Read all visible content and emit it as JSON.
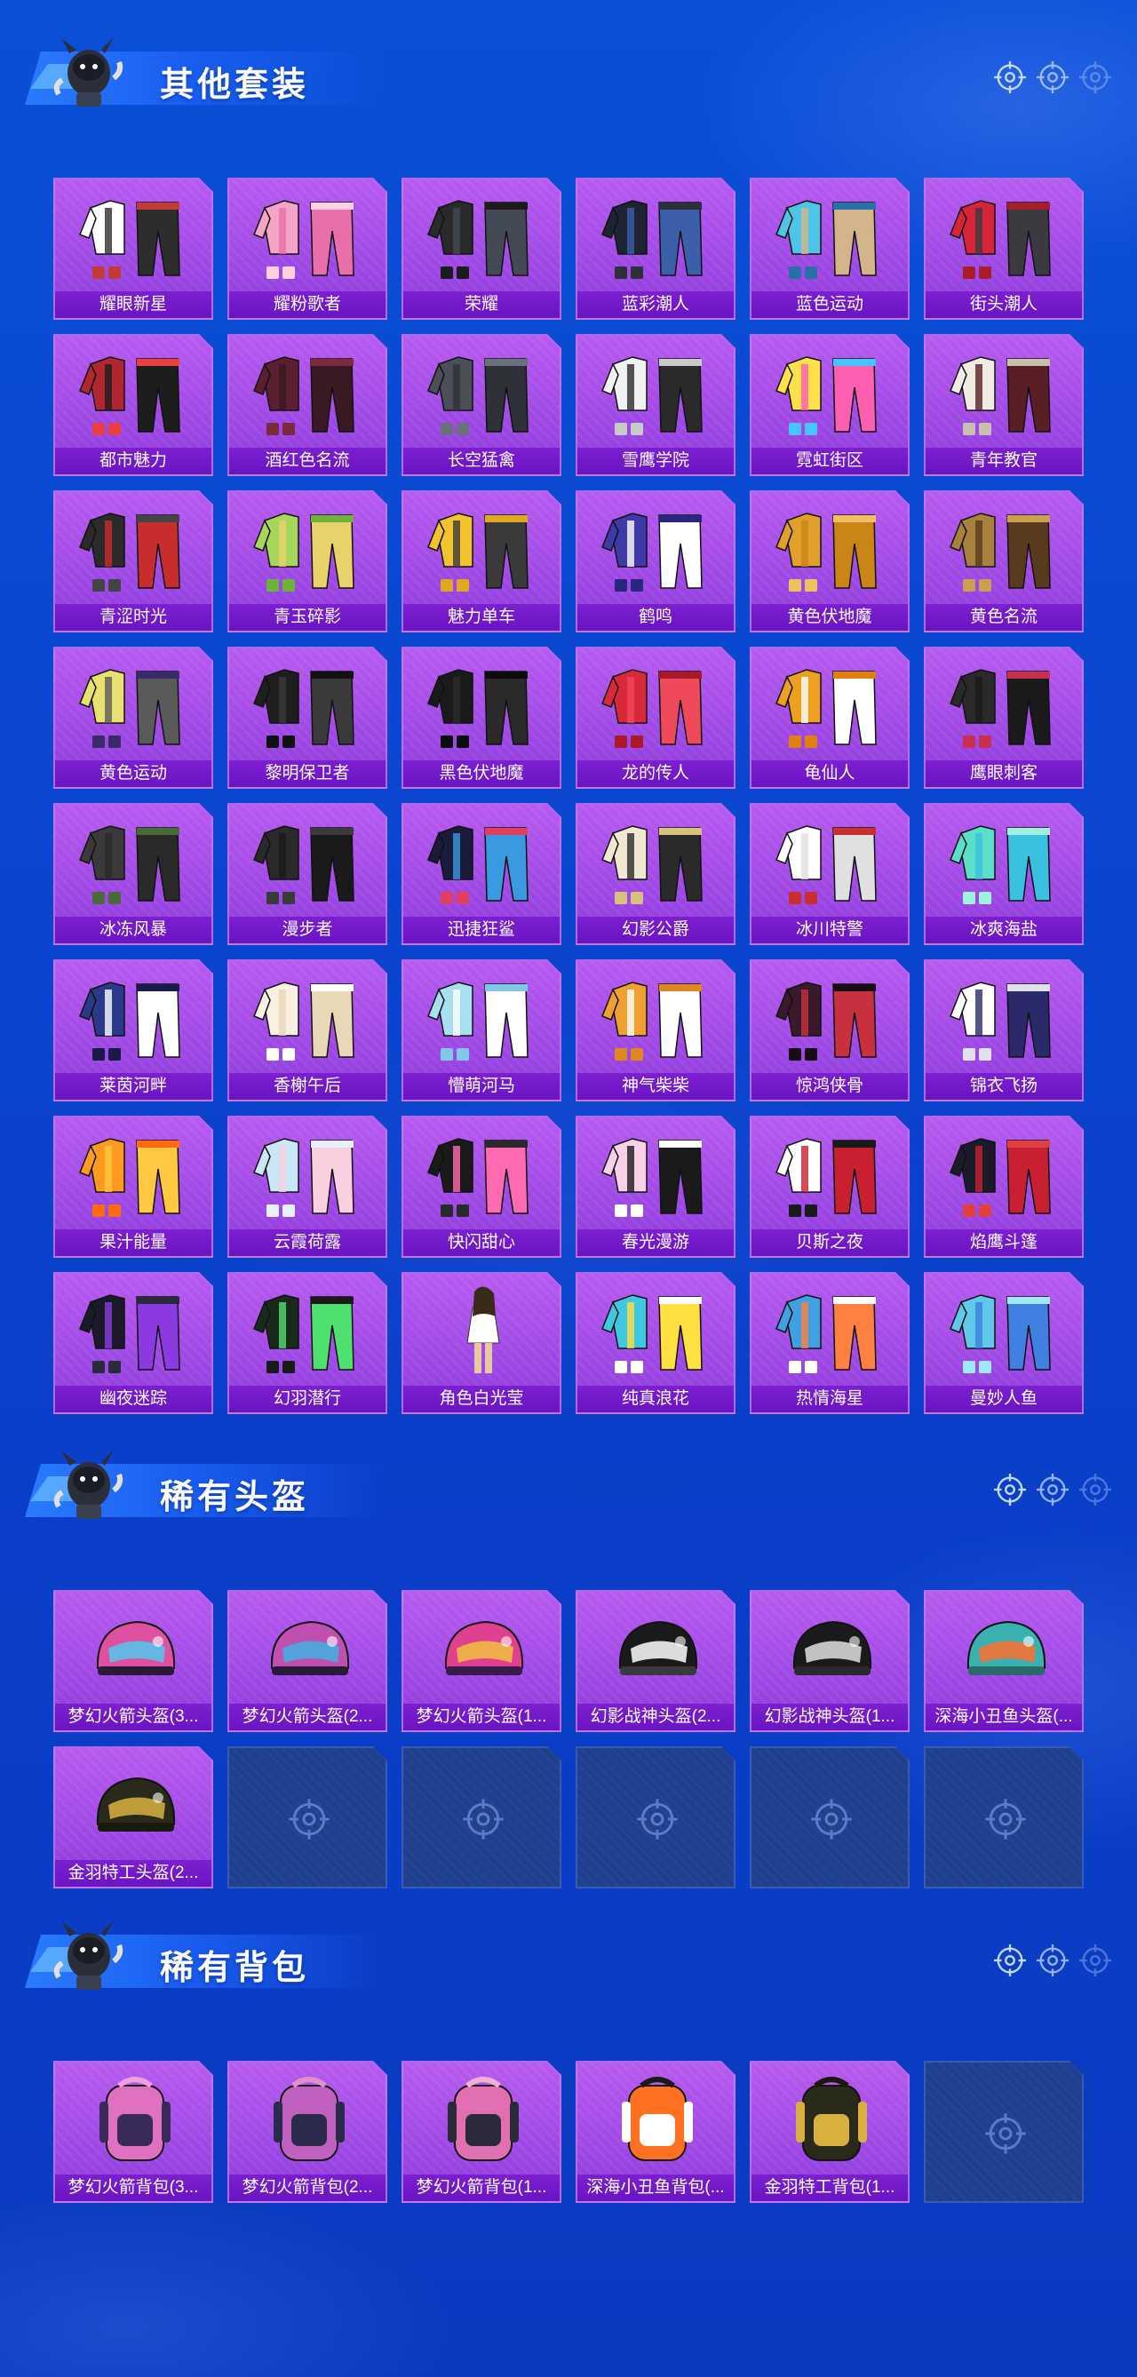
{
  "colors": {
    "accent": "#b75bf0",
    "banner": "#2a7bff",
    "empty_slot": "#1f3f8f"
  },
  "sections": [
    {
      "title": "其他套装",
      "items": [
        {
          "label": "耀眼新星",
          "icon": "outfit-icon",
          "pal": [
            "#ffffff",
            "#2d2d2d",
            "#c23a3a"
          ]
        },
        {
          "label": "耀粉歌者",
          "icon": "outfit-icon",
          "pal": [
            "#f5a4c8",
            "#e86fa8",
            "#ffd0e0"
          ]
        },
        {
          "label": "荣耀",
          "icon": "outfit-icon",
          "pal": [
            "#2a2a2a",
            "#444a55",
            "#1c1c1c"
          ]
        },
        {
          "label": "蓝彩潮人",
          "icon": "outfit-icon",
          "pal": [
            "#1e2433",
            "#3b5fa8",
            "#2f2f3a"
          ]
        },
        {
          "label": "蓝色运动",
          "icon": "outfit-icon",
          "pal": [
            "#4ec5e6",
            "#d4b48a",
            "#2b6fa8"
          ]
        },
        {
          "label": "街头潮人",
          "icon": "outfit-icon",
          "pal": [
            "#d8243a",
            "#3a3a40",
            "#a81c2c"
          ]
        },
        {
          "label": "都市魅力",
          "icon": "outfit-icon",
          "pal": [
            "#b0272f",
            "#1d1d1d",
            "#e64040"
          ]
        },
        {
          "label": "酒红色名流",
          "icon": "outfit-icon",
          "pal": [
            "#5b2030",
            "#3a1a22",
            "#7a2a3c"
          ]
        },
        {
          "label": "长空猛禽",
          "icon": "outfit-icon",
          "pal": [
            "#4a4f58",
            "#2e3238",
            "#6b717a"
          ]
        },
        {
          "label": "雪鹰学院",
          "icon": "outfit-icon",
          "pal": [
            "#f2f2f2",
            "#2a2a2a",
            "#c9c9c9"
          ]
        },
        {
          "label": "霓虹街区",
          "icon": "outfit-icon",
          "pal": [
            "#ffe04a",
            "#ff5fb0",
            "#49c3ff"
          ]
        },
        {
          "label": "青年教官",
          "icon": "outfit-icon",
          "pal": [
            "#f0ece4",
            "#5a1f25",
            "#c9bfae"
          ]
        },
        {
          "label": "青涩时光",
          "icon": "outfit-icon",
          "pal": [
            "#2b2b2b",
            "#c82d2d",
            "#444"
          ]
        },
        {
          "label": "青玉碎影",
          "icon": "outfit-icon",
          "pal": [
            "#a6d65a",
            "#e8d26a",
            "#6fb23a"
          ]
        },
        {
          "label": "魅力单车",
          "icon": "outfit-icon",
          "pal": [
            "#f2c230",
            "#3a3a3a",
            "#e0a820"
          ]
        },
        {
          "label": "鹤鸣",
          "icon": "outfit-icon",
          "pal": [
            "#3f3aa8",
            "#ffffff",
            "#2a2680"
          ]
        },
        {
          "label": "黄色伏地魔",
          "icon": "outfit-icon",
          "pal": [
            "#e0a02a",
            "#c98616",
            "#f0c060"
          ]
        },
        {
          "label": "黄色名流",
          "icon": "outfit-icon",
          "pal": [
            "#a8813c",
            "#5a3a1c",
            "#c9a050"
          ]
        },
        {
          "label": "黄色运动",
          "icon": "outfit-icon",
          "pal": [
            "#e8e070",
            "#5a5a5a",
            "#3a2a6a"
          ]
        },
        {
          "label": "黎明保卫者",
          "icon": "outfit-icon",
          "pal": [
            "#1e1e1e",
            "#3a3a3a",
            "#111"
          ]
        },
        {
          "label": "黑色伏地魔",
          "icon": "outfit-icon",
          "pal": [
            "#1a1a1a",
            "#2a2a2a",
            "#0c0c0c"
          ]
        },
        {
          "label": "龙的传人",
          "icon": "outfit-icon",
          "pal": [
            "#d8283a",
            "#f04a5a",
            "#a81a2a"
          ]
        },
        {
          "label": "龟仙人",
          "icon": "outfit-icon",
          "pal": [
            "#f0a020",
            "#ffffff",
            "#e08010"
          ]
        },
        {
          "label": "鹰眼刺客",
          "icon": "outfit-icon",
          "pal": [
            "#2a2a2a",
            "#1a1a1a",
            "#c83050"
          ]
        },
        {
          "label": "冰冻风暴",
          "icon": "outfit-icon",
          "pal": [
            "#3a3a3a",
            "#2a2a2a",
            "#4a6a3a"
          ]
        },
        {
          "label": "漫步者",
          "icon": "outfit-icon",
          "pal": [
            "#2a2a2a",
            "#1a1a1a",
            "#3a3a3a"
          ]
        },
        {
          "label": "迅捷狂鲨",
          "icon": "outfit-icon",
          "pal": [
            "#1a1a3a",
            "#3a9ae0",
            "#e04060"
          ]
        },
        {
          "label": "幻影公爵",
          "icon": "outfit-icon",
          "pal": [
            "#f0e8d0",
            "#2a2a2a",
            "#d8c080"
          ]
        },
        {
          "label": "冰川特警",
          "icon": "outfit-icon",
          "pal": [
            "#ffffff",
            "#e0e0e0",
            "#c83030"
          ]
        },
        {
          "label": "冰爽海盐",
          "icon": "outfit-icon",
          "pal": [
            "#5ae0c8",
            "#3ac0e0",
            "#a0f0e0"
          ]
        },
        {
          "label": "莱茵河畔",
          "icon": "outfit-icon",
          "pal": [
            "#2a3a8a",
            "#ffffff",
            "#1a1a4a"
          ]
        },
        {
          "label": "香榭午后",
          "icon": "outfit-icon",
          "pal": [
            "#f8f0e0",
            "#e8d8b8",
            "#ffffff"
          ]
        },
        {
          "label": "懵萌河马",
          "icon": "outfit-icon",
          "pal": [
            "#a8e0f0",
            "#ffffff",
            "#80c8e8"
          ]
        },
        {
          "label": "神气柴柴",
          "icon": "outfit-icon",
          "pal": [
            "#f0a030",
            "#ffffff",
            "#e08820"
          ]
        },
        {
          "label": "惊鸿侠骨",
          "icon": "outfit-icon",
          "pal": [
            "#3a1a2a",
            "#c83040",
            "#1a0c14"
          ]
        },
        {
          "label": "锦衣飞扬",
          "icon": "outfit-icon",
          "pal": [
            "#ffffff",
            "#2a2a6a",
            "#e0e0f0"
          ]
        },
        {
          "label": "果汁能量",
          "icon": "outfit-icon",
          "pal": [
            "#ff9a20",
            "#ffc840",
            "#ff6a10"
          ]
        },
        {
          "label": "云霞荷露",
          "icon": "outfit-icon",
          "pal": [
            "#c8e8f8",
            "#f8d0e0",
            "#e8f0ff"
          ]
        },
        {
          "label": "快闪甜心",
          "icon": "outfit-icon",
          "pal": [
            "#1a1a1a",
            "#ff6ab0",
            "#2a2a2a"
          ]
        },
        {
          "label": "春光漫游",
          "icon": "outfit-icon",
          "pal": [
            "#f8d0e8",
            "#1a1a1a",
            "#ffffff"
          ]
        },
        {
          "label": "贝斯之夜",
          "icon": "outfit-icon",
          "pal": [
            "#ffffff",
            "#c82030",
            "#1a1a1a"
          ]
        },
        {
          "label": "焰鹰斗篷",
          "icon": "outfit-icon",
          "pal": [
            "#1a1a2a",
            "#c82030",
            "#e04040"
          ]
        },
        {
          "label": "幽夜迷踪",
          "icon": "outfit-icon",
          "pal": [
            "#1a1a2a",
            "#8a3ae0",
            "#2a2a3a"
          ]
        },
        {
          "label": "幻羽潜行",
          "icon": "outfit-icon",
          "pal": [
            "#1a2a1a",
            "#50e070",
            "#1a1a1a"
          ]
        },
        {
          "label": "角色白光莹",
          "icon": "character-icon",
          "pal": [
            "#e8c8a0",
            "#ffffff",
            "#3a2a1a"
          ]
        },
        {
          "label": "纯真浪花",
          "icon": "outfit-icon",
          "pal": [
            "#40c8e0",
            "#ffe040",
            "#ffffff"
          ]
        },
        {
          "label": "热情海星",
          "icon": "outfit-icon",
          "pal": [
            "#40a0e0",
            "#ff8040",
            "#ffffff"
          ]
        },
        {
          "label": "曼妙人鱼",
          "icon": "outfit-icon",
          "pal": [
            "#60c8e8",
            "#4080e0",
            "#a0e8f8"
          ]
        }
      ],
      "empty_slots": 0
    },
    {
      "title": "稀有头盔",
      "items": [
        {
          "label": "梦幻火箭头盔(3...",
          "icon": "helmet-icon",
          "pal": [
            "#e050a0",
            "#50c8f0",
            "#2a1a3a"
          ]
        },
        {
          "label": "梦幻火箭头盔(2...",
          "icon": "helmet-icon",
          "pal": [
            "#c050b0",
            "#40b0e0",
            "#2a1a3a"
          ]
        },
        {
          "label": "梦幻火箭头盔(1...",
          "icon": "helmet-icon",
          "pal": [
            "#e04090",
            "#f0c040",
            "#3a1a4a"
          ]
        },
        {
          "label": "幻影战神头盔(2...",
          "icon": "helmet-icon",
          "pal": [
            "#1a1a1a",
            "#ffffff",
            "#3a3a3a"
          ]
        },
        {
          "label": "幻影战神头盔(1...",
          "icon": "helmet-icon",
          "pal": [
            "#1a1a1a",
            "#e0e0e0",
            "#2a2a2a"
          ]
        },
        {
          "label": "深海小丑鱼头盔(...",
          "icon": "helmet-icon",
          "pal": [
            "#3ab0b0",
            "#ff7030",
            "#2a6a6a"
          ]
        },
        {
          "label": "金羽特工头盔(2...",
          "icon": "helmet-icon",
          "pal": [
            "#2a2a1a",
            "#d8b040",
            "#1a1a0c"
          ]
        }
      ],
      "empty_slots": 5
    },
    {
      "title": "稀有背包",
      "items": [
        {
          "label": "梦幻火箭背包(3...",
          "icon": "backpack-icon",
          "pal": [
            "#e070c0",
            "#3a2a5a",
            "#f0a0e0"
          ]
        },
        {
          "label": "梦幻火箭背包(2...",
          "icon": "backpack-icon",
          "pal": [
            "#c060c0",
            "#2a2a4a",
            "#e090d0"
          ]
        },
        {
          "label": "梦幻火箭背包(1...",
          "icon": "backpack-icon",
          "pal": [
            "#e070b0",
            "#2a2a3a",
            "#f0b0d0"
          ]
        },
        {
          "label": "深海小丑鱼背包(...",
          "icon": "backpack-icon",
          "pal": [
            "#ff7020",
            "#ffffff",
            "#1a1a1a"
          ]
        },
        {
          "label": "金羽特工背包(1...",
          "icon": "backpack-icon",
          "pal": [
            "#2a2a1a",
            "#d8b040",
            "#1a1a0c"
          ]
        }
      ],
      "empty_slots": 1
    }
  ]
}
